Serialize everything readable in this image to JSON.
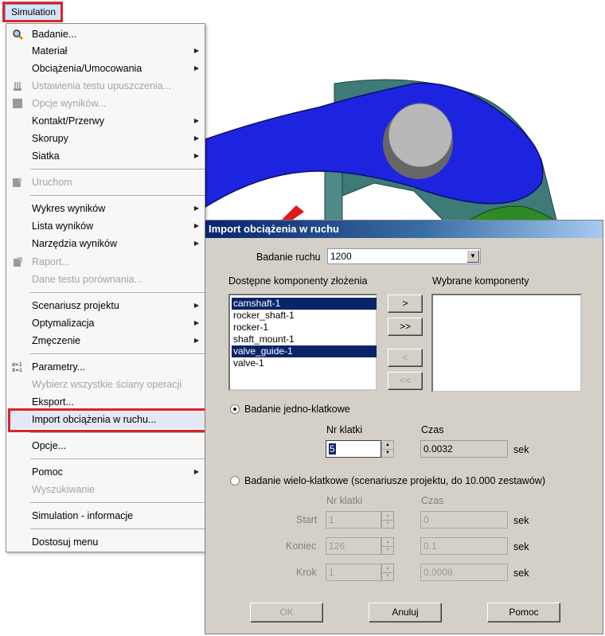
{
  "menu_button": {
    "label": "Simulation"
  },
  "menu": {
    "items": [
      {
        "label": "Badanie...",
        "icon": "magnifier-icon",
        "enabled": true
      },
      {
        "label": "Materiał",
        "submenu": true,
        "enabled": true
      },
      {
        "label": "Obciążenia/Umocowania",
        "submenu": true,
        "enabled": true
      },
      {
        "label": "Ustawienia testu upuszczenia...",
        "icon": "drop-test-icon",
        "enabled": false
      },
      {
        "label": "Opcje wyników...",
        "icon": "result-options-icon",
        "enabled": false
      },
      {
        "label": "Kontakt/Przerwy",
        "submenu": true,
        "enabled": true
      },
      {
        "label": "Skorupy",
        "submenu": true,
        "enabled": true
      },
      {
        "label": "Siatka",
        "submenu": true,
        "enabled": true
      },
      {
        "label": "Uruchom",
        "icon": "run-icon",
        "enabled": false
      },
      {
        "label": "Wykres wyników",
        "submenu": true,
        "enabled": true
      },
      {
        "label": "Lista wyników",
        "submenu": true,
        "enabled": true
      },
      {
        "label": "Narzędzia wyników",
        "submenu": true,
        "enabled": true
      },
      {
        "label": "Raport...",
        "icon": "report-icon",
        "enabled": false
      },
      {
        "label": "Dane testu porównania...",
        "enabled": false
      },
      {
        "label": "Scenariusz projektu",
        "submenu": true,
        "enabled": true
      },
      {
        "label": "Optymalizacja",
        "submenu": true,
        "enabled": true
      },
      {
        "label": "Zmęczenie",
        "submenu": true,
        "enabled": true
      },
      {
        "label": "Parametry...",
        "icon": "parameters-icon",
        "enabled": true
      },
      {
        "label": "Wybierz wszystkie ściany operacji",
        "enabled": false
      },
      {
        "label": "Eksport...",
        "enabled": true
      },
      {
        "label": "Import obciążenia w ruchu...",
        "enabled": true,
        "highlighted": true
      },
      {
        "label": "Opcje...",
        "enabled": true
      },
      {
        "label": "Pomoc",
        "submenu": true,
        "enabled": true
      },
      {
        "label": "Wyszukiwanie",
        "enabled": false
      },
      {
        "label": "Simulation - informacje",
        "enabled": true
      },
      {
        "label": "Dostosuj menu",
        "enabled": true
      }
    ]
  },
  "dialog": {
    "title": "Import obciążenia w ruchu",
    "motion_study_label": "Badanie ruchu",
    "motion_study_value": "1200",
    "available_label": "Dostępne komponenty złożenia",
    "selected_label": "Wybrane komponenty",
    "available_items": [
      {
        "name": "camshaft-1",
        "selected": true
      },
      {
        "name": "rocker_shaft-1",
        "selected": false
      },
      {
        "name": "rocker-1",
        "selected": false
      },
      {
        "name": "shaft_mount-1",
        "selected": false
      },
      {
        "name": "valve_guide-1",
        "selected": true
      },
      {
        "name": "valve-1",
        "selected": false
      }
    ],
    "move_buttons": {
      "add": ">",
      "add_all": ">>",
      "remove": "<",
      "remove_all": "<<"
    },
    "single_frame": {
      "label": "Badanie jedno-klatkowe",
      "checked": true,
      "frame_label": "Nr klatki",
      "time_label": "Czas",
      "frame_value": "5",
      "time_value": "0.0032",
      "time_unit": "sek"
    },
    "multi_frame": {
      "label": "Badanie wielo-klatkowe (scenariusze projektu, do 10.000 zestawów)",
      "checked": false,
      "frame_label": "Nr klatki",
      "time_label": "Czas",
      "rows": [
        {
          "label": "Start",
          "frame": "1",
          "time": "0",
          "unit": "sek"
        },
        {
          "label": "Koniec",
          "frame": "126",
          "time": "0.1",
          "unit": "sek"
        },
        {
          "label": "Krok",
          "frame": "1",
          "time": "0.0008",
          "unit": "sek"
        }
      ]
    },
    "buttons": {
      "ok": "OK",
      "cancel": "Anuluj",
      "help": "Pomoc"
    }
  },
  "colors": {
    "highlight_box": "#d9252b",
    "dialog_title": "#0a246a",
    "list_selection": "#0a246a",
    "part_blue": "#1d24e0"
  }
}
